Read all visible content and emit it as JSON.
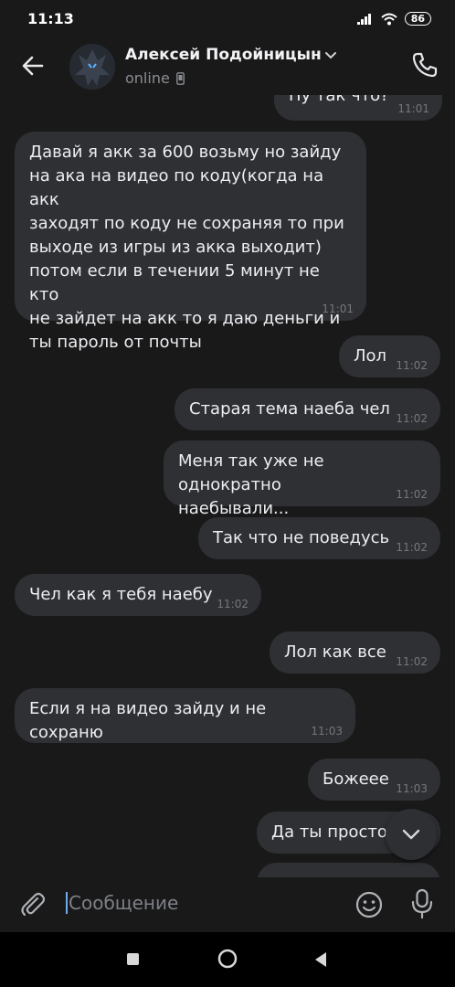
{
  "status_bar": {
    "time": "11:13",
    "battery": "86"
  },
  "header": {
    "name": "Алексей Подойницын",
    "status": "online"
  },
  "messages": [
    {
      "text": "Ну так что?",
      "time": "11:01"
    },
    {
      "text": "Давай я акк за 600 возьму но зайду\nна ака на видео по коду(когда на акк\nзаходят по коду не сохраняя то при\nвыходе из игры из акка выходит)\nпотом если в течении 5 минут не кто\nне зайдет на акк то я даю деньги и\nты пароль от почты",
      "time": "11:01"
    },
    {
      "text": "Лол",
      "time": "11:02"
    },
    {
      "text": "Старая тема наеба чел",
      "time": "11:02"
    },
    {
      "text": "Меня так уже не однократно\nнаебывали...",
      "time": "11:02"
    },
    {
      "text": "Так что не поведусь",
      "time": "11:02"
    },
    {
      "text": "Чел как я тебя наебу",
      "time": "11:02"
    },
    {
      "text": "Лол как все",
      "time": "11:02"
    },
    {
      "text": "Если я на видео зайду и не сохраню",
      "time": "11:03"
    },
    {
      "text": "Божеее",
      "time": "11:03"
    },
    {
      "text": "Да ты просто",
      "time": ""
    }
  ],
  "composer": {
    "placeholder": "Сообщение"
  },
  "icons": {
    "back": "arrow-left-icon",
    "call": "phone-icon",
    "attach": "paperclip-icon",
    "emoji": "smile-icon",
    "mic": "microphone-icon",
    "scroll": "chevron-down-icon"
  },
  "colors": {
    "background": "#19191a",
    "bubble": "#2f3033",
    "accent": "#71aaeb"
  }
}
